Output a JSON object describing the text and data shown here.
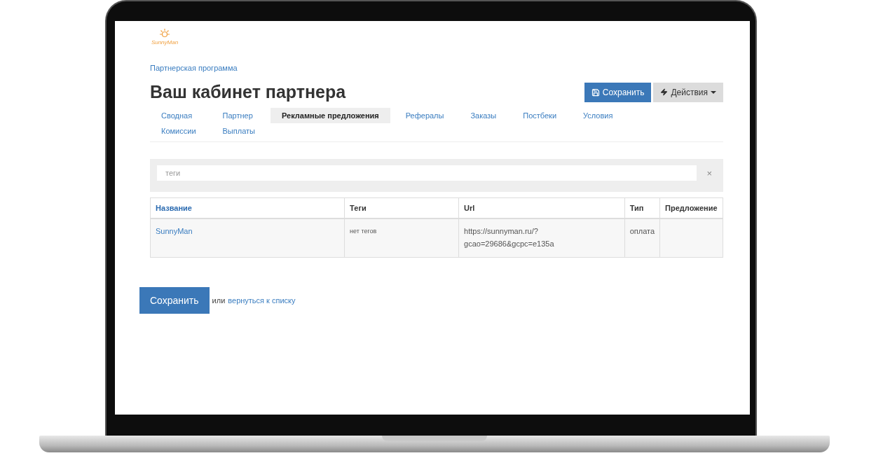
{
  "logo": {
    "text": "SunnyMan"
  },
  "breadcrumb": "Партнерская программа",
  "title": "Ваш кабинет партнера",
  "header_buttons": [
    {
      "label": "Сохранить",
      "kind": "primary"
    },
    {
      "label": "Действия",
      "kind": "dropdown"
    }
  ],
  "tabs": [
    {
      "label": "Сводная",
      "selected": false
    },
    {
      "label": "Партнер",
      "selected": false
    },
    {
      "label": "Рекламные предложения",
      "selected": true
    },
    {
      "label": "Рефералы",
      "selected": false
    },
    {
      "label": "Заказы",
      "selected": false
    },
    {
      "label": "Постбеки",
      "selected": false
    },
    {
      "label": "Условия",
      "selected": false
    },
    {
      "label": "Комиссии",
      "selected": false
    },
    {
      "label": "Выплаты",
      "selected": false
    }
  ],
  "filter": {
    "placeholder": "теги",
    "clear": "×"
  },
  "table": {
    "columns": [
      {
        "label": "Название",
        "sorted": true
      },
      {
        "label": "Теги",
        "sorted": false
      },
      {
        "label": "Url",
        "sorted": false
      },
      {
        "label": "Тип",
        "sorted": false
      },
      {
        "label": "Предложение",
        "sorted": false
      }
    ],
    "rows": [
      {
        "name": "SunnyMan",
        "tags": "нет тегов",
        "url": "https://sunnyman.ru/?gcao=29686&gcpc=e135a",
        "type": "оплата"
      }
    ]
  },
  "footer": {
    "button": "Сохранить",
    "or": "или",
    "link": "вернуться к списку"
  }
}
